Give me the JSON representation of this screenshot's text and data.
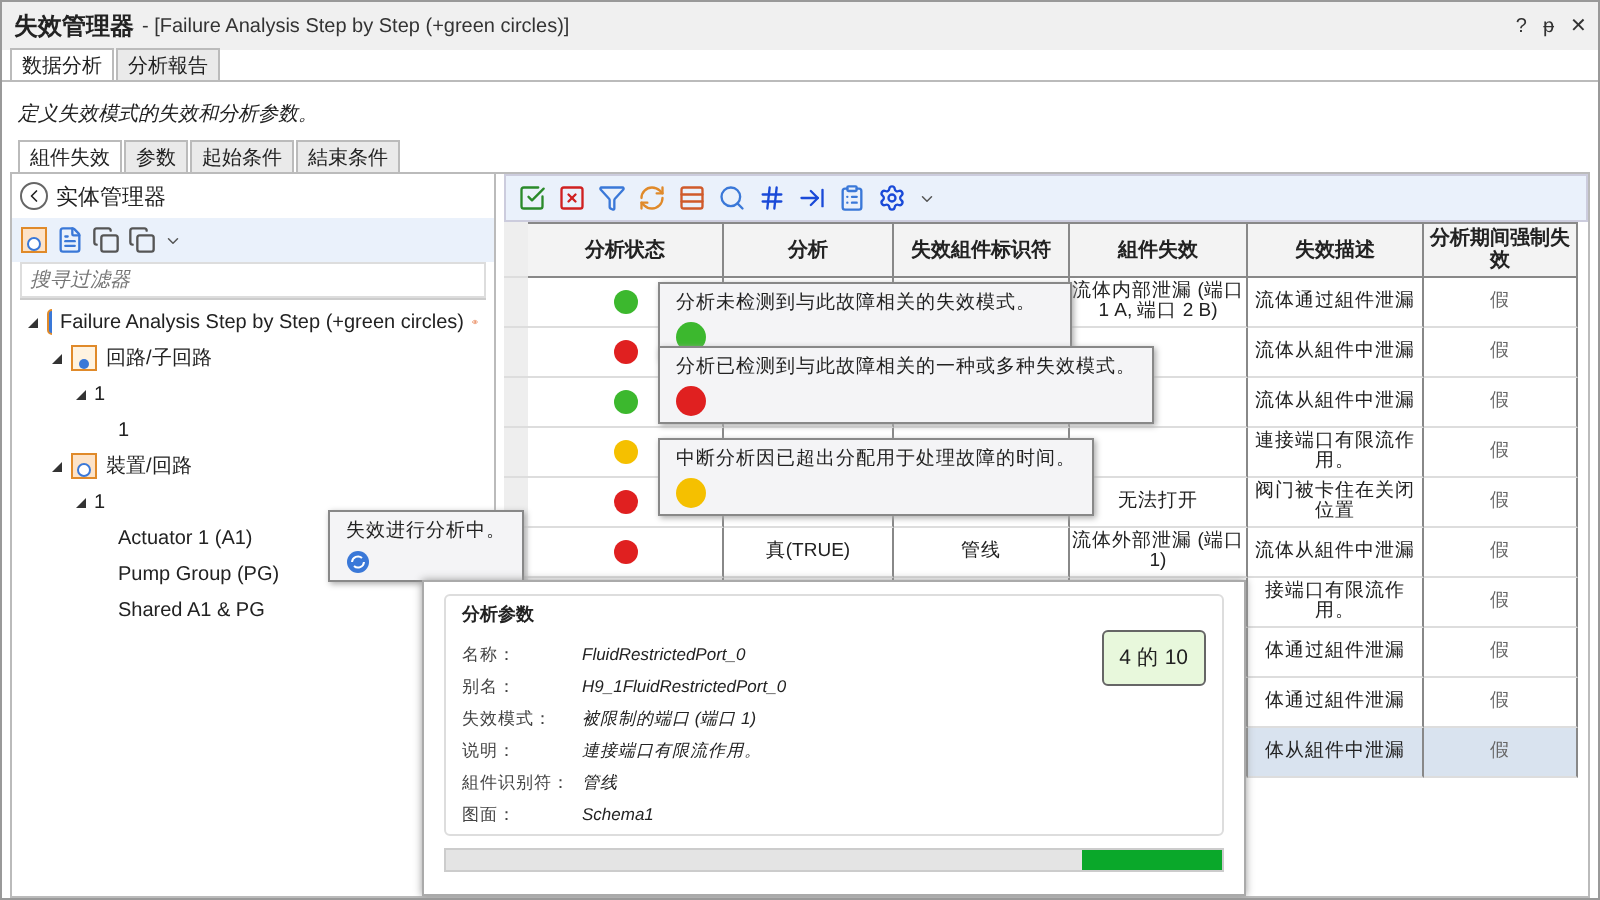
{
  "window": {
    "title": "失效管理器",
    "subtitle": "- [Failure Analysis Step by Step (+green circles)]",
    "controls": [
      "?",
      "ᵽ",
      "✕"
    ]
  },
  "tabs": [
    {
      "label": "数据分析",
      "selected": true
    },
    {
      "label": "分析報告",
      "selected": false
    }
  ],
  "description": "定义失效模式的失效和分析参数。",
  "inner_tabs": [
    {
      "label": "組件失效",
      "selected": true
    },
    {
      "label": "参数",
      "selected": false
    },
    {
      "label": "起始条件",
      "selected": false
    },
    {
      "label": "結束条件",
      "selected": false
    }
  ],
  "entity_manager": {
    "title": "实体管理器",
    "search": {
      "placeholder": "搜寻过滤器"
    },
    "tree": [
      {
        "label": "Failure Analysis Step by Step (+green circles)",
        "kind": "project",
        "expanded": true,
        "children": [
          {
            "label": "回路/子回路",
            "kind": "circuit",
            "expanded": true,
            "children": [
              {
                "label": "1",
                "expanded": true,
                "children": [
                  {
                    "label": "1"
                  }
                ]
              }
            ]
          },
          {
            "label": "裝置/回路",
            "kind": "device",
            "expanded": true,
            "children": [
              {
                "label": "1",
                "expanded": true,
                "children": [
                  {
                    "label": "Actuator 1 (A1)"
                  },
                  {
                    "label": "Pump Group (PG)"
                  },
                  {
                    "label": "Shared A1 & PG"
                  }
                ]
              }
            ]
          }
        ]
      }
    ]
  },
  "progress_tooltip": {
    "text": "失效进行分析中。"
  },
  "table": {
    "columns": [
      "分析状态",
      "分析",
      "失效組件标识符",
      "組件失效",
      "失效描述",
      "分析期间强制失效"
    ],
    "rows": [
      {
        "color": "#3cb82e",
        "failure": "流体内部泄漏 (端口 1 A, 端口 2 B)",
        "description": "流体通过組件泄漏",
        "forced": "假",
        "selected": false
      },
      {
        "color": "#e02020",
        "description": "流体从組件中泄漏",
        "forced": "假",
        "selected": false
      },
      {
        "color": "#3cb82e",
        "description": "流体从組件中泄漏",
        "forced": "假",
        "selected": false
      },
      {
        "color": "#f5c000",
        "description": "連接端口有限流作用。",
        "forced": "假",
        "selected": false
      },
      {
        "color": "#e02020",
        "failure": "无法打开",
        "description": "阀门被卡住在关闭位置",
        "forced": "假",
        "selected": false
      },
      {
        "color": "#e02020",
        "analysis": "真(TRUE)",
        "identifier": "管线",
        "failure": "流体外部泄漏 (端口 1)",
        "description": "流体从組件中泄漏",
        "forced": "假",
        "selected": false
      },
      {
        "description": "接端口有限流作用。",
        "forced": "假",
        "selected": false
      },
      {
        "description": "体通过組件泄漏",
        "forced": "假",
        "selected": false
      },
      {
        "description": "体通过組件泄漏",
        "forced": "假",
        "selected": false
      },
      {
        "description": "体从組件中泄漏",
        "forced": "假",
        "selected": true
      }
    ]
  },
  "status_tooltips": [
    {
      "text": "分析未检测到与此故障相关的失效模式。",
      "color": "#3cb82e"
    },
    {
      "text": "分析已检测到与此故障相关的一种或多种失效模式。",
      "color": "#e02020"
    },
    {
      "text": "中断分析因已超出分配用于处理故障的时间。",
      "color": "#f5c000"
    }
  ],
  "analysis_dialog": {
    "group_title": "分析参数",
    "fields": [
      {
        "label": "名称：",
        "value": "FluidRestrictedPort_0"
      },
      {
        "label": "别名：",
        "value": "H9_1FluidRestrictedPort_0"
      },
      {
        "label": "失效模式：",
        "value": "被限制的端口 (端口 1)"
      },
      {
        "label": "说明：",
        "value": "連接端口有限流作用。"
      },
      {
        "label": "組件识别符：",
        "value": "管线"
      },
      {
        "label": "图面：",
        "value": "Schema1"
      }
    ],
    "counter": "4 的 10",
    "progress": {
      "level": 0.18
    }
  }
}
